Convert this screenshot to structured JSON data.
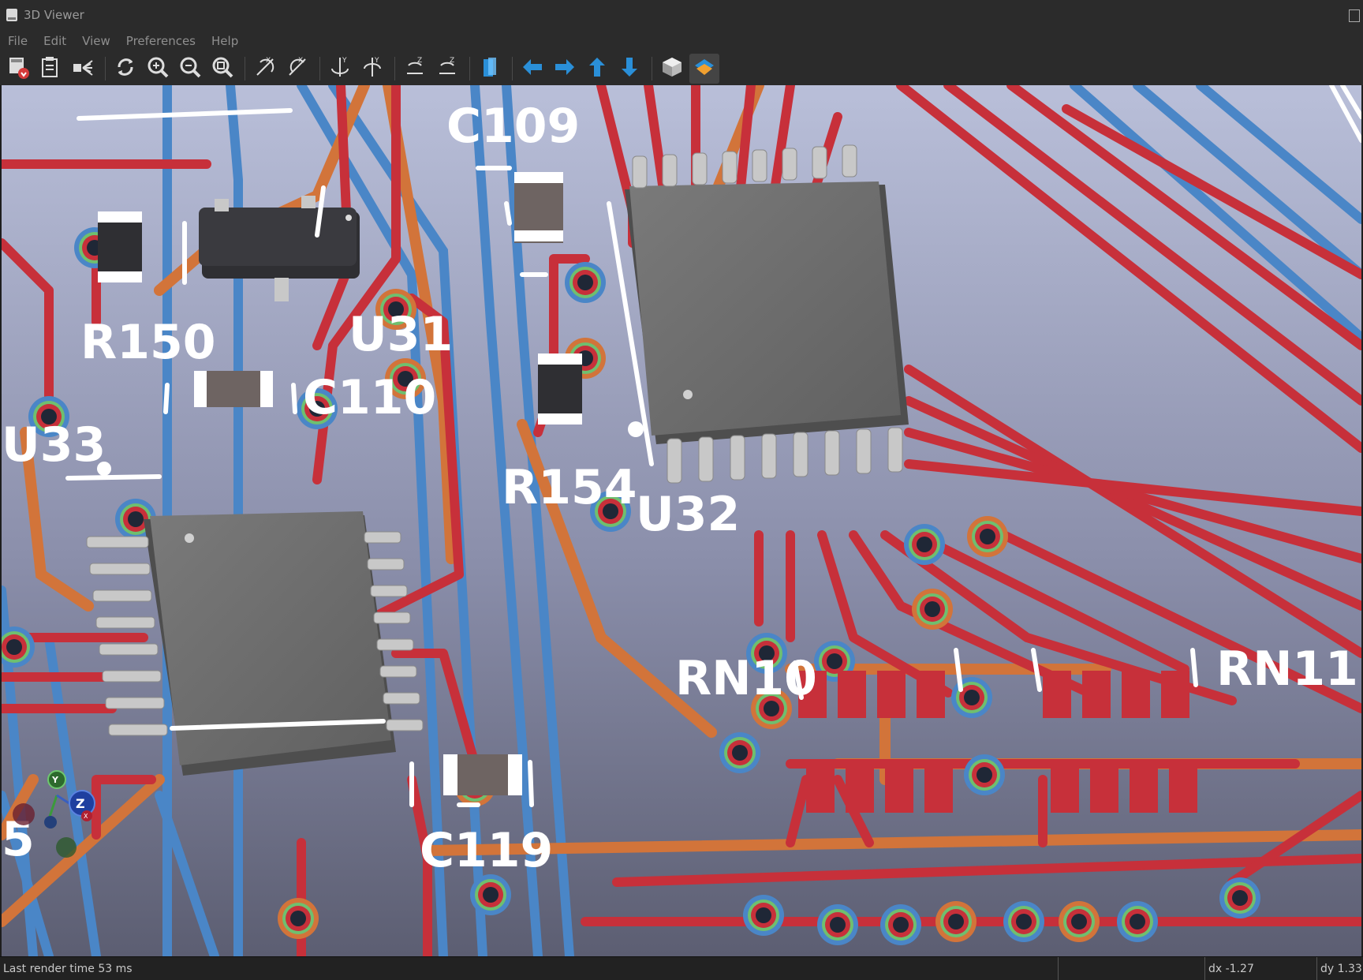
{
  "window": {
    "title": "3D Viewer"
  },
  "menu": [
    "File",
    "Edit",
    "View",
    "Preferences",
    "Help"
  ],
  "toolbar": [
    {
      "icon": "reload-board-icon"
    },
    {
      "icon": "copy-clipboard-icon"
    },
    {
      "icon": "raytrace-icon"
    },
    {
      "sep": true
    },
    {
      "icon": "refresh-icon"
    },
    {
      "icon": "zoom-in-icon"
    },
    {
      "icon": "zoom-out-icon"
    },
    {
      "icon": "zoom-fit-icon"
    },
    {
      "sep": true
    },
    {
      "icon": "rotate-x-cw-icon"
    },
    {
      "icon": "rotate-x-ccw-icon"
    },
    {
      "sep": true
    },
    {
      "icon": "rotate-y-cw-icon"
    },
    {
      "icon": "rotate-y-ccw-icon"
    },
    {
      "sep": true
    },
    {
      "icon": "rotate-z-cw-icon"
    },
    {
      "icon": "rotate-z-ccw-icon"
    },
    {
      "sep": true
    },
    {
      "icon": "flip-board-icon"
    },
    {
      "sep": true
    },
    {
      "icon": "move-left-icon"
    },
    {
      "icon": "move-right-icon"
    },
    {
      "icon": "move-up-icon"
    },
    {
      "icon": "move-down-icon"
    },
    {
      "sep": true
    },
    {
      "icon": "ortho-toggle-icon"
    },
    {
      "icon": "layers-toggle-icon",
      "active": true
    }
  ],
  "labels": {
    "c109": "C109",
    "r150": "R150",
    "u31": "U31",
    "c110": "C110",
    "u33": "U33",
    "r154": "R154",
    "u32": "U32",
    "rn10": "RN10",
    "rn11": "RN11",
    "c119": "C119",
    "edge5": "5"
  },
  "axes": {
    "x": "X",
    "y": "Y",
    "z": "Z"
  },
  "status": {
    "render": "Last render time 53 ms",
    "dx": "dx -1.27",
    "dy": "dy 1.33"
  },
  "colors": {
    "copper_front": "#c7303a",
    "copper_back": "#4a86c7",
    "copper_inner": "#d2743a",
    "silkscreen": "#ffffff",
    "ic_body": "#6b6b6b",
    "pin": "#c8c8c8"
  }
}
